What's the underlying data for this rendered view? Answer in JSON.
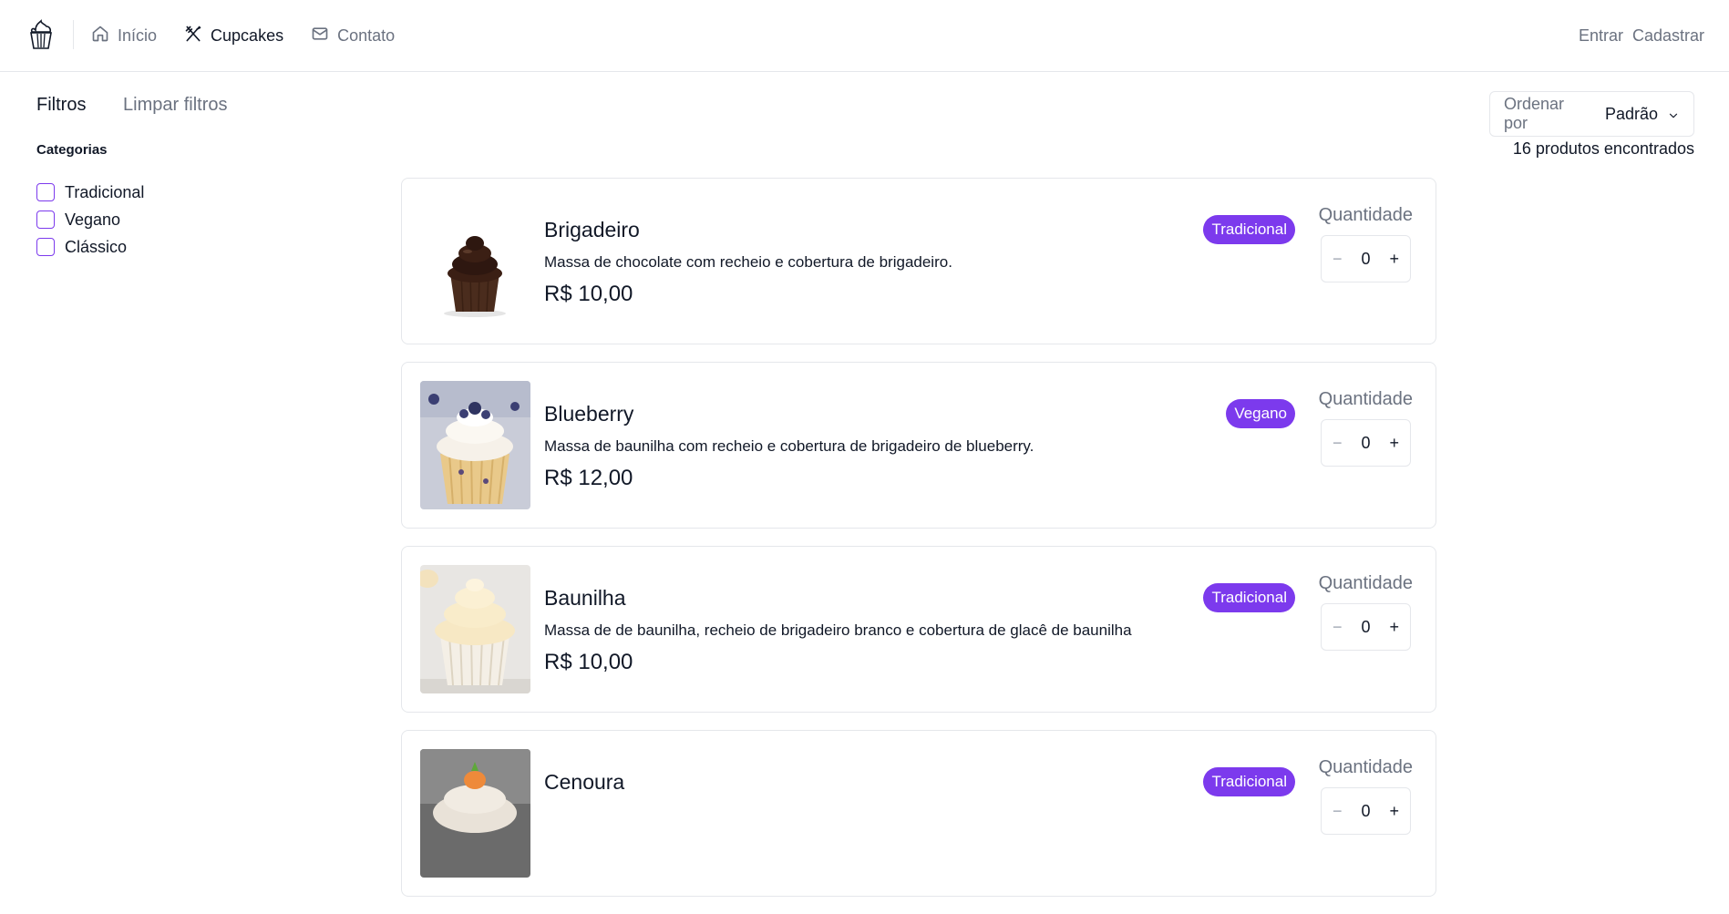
{
  "nav": {
    "items": [
      {
        "label": "Início",
        "icon": "home-icon"
      },
      {
        "label": "Cupcakes",
        "icon": "utensils-crossed-icon"
      },
      {
        "label": "Contato",
        "icon": "mail-icon"
      }
    ],
    "login": "Entrar",
    "signup": "Cadastrar"
  },
  "filters": {
    "title": "Filtros",
    "clear": "Limpar filtros",
    "categories_title": "Categorias",
    "categories": [
      "Tradicional",
      "Vegano",
      "Clássico"
    ]
  },
  "sort": {
    "label": "Ordenar por",
    "value": "Padrão"
  },
  "results": "16 produtos encontrados",
  "quantity_label": "Quantidade",
  "products": [
    {
      "name": "Brigadeiro",
      "description": "Massa de chocolate com recheio e cobertura de brigadeiro.",
      "price": "R$ 10,00",
      "badge": "Tradicional",
      "qty": "0"
    },
    {
      "name": "Blueberry",
      "description": "Massa de baunilha com recheio e cobertura de brigadeiro de blueberry.",
      "price": "R$ 12,00",
      "badge": "Vegano",
      "qty": "0"
    },
    {
      "name": "Baunilha",
      "description": "Massa de de baunilha, recheio de brigadeiro branco e cobertura de glacê de baunilha",
      "price": "R$ 10,00",
      "badge": "Tradicional",
      "qty": "0"
    },
    {
      "name": "Cenoura",
      "description": "",
      "price": "",
      "badge": "Tradicional",
      "qty": "0"
    }
  ],
  "colors": {
    "accent": "#7c3aed",
    "muted": "#6b7280",
    "border": "#e5e7eb"
  }
}
